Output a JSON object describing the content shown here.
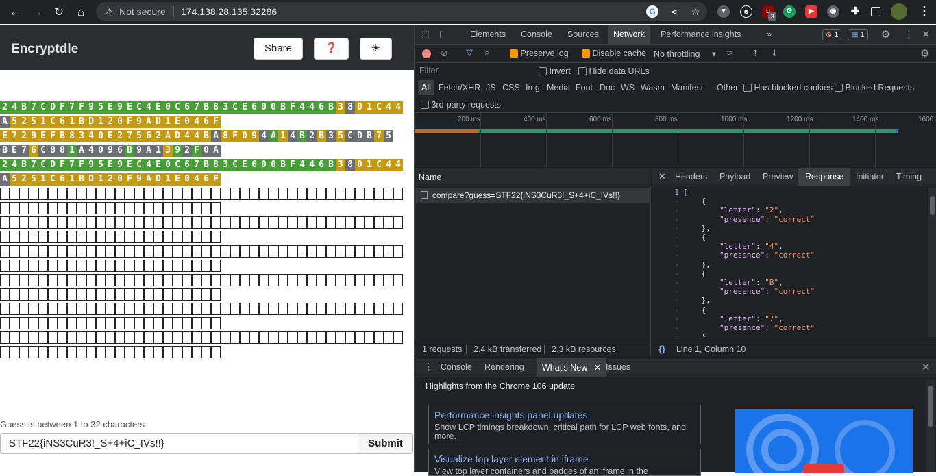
{
  "browser": {
    "security_label": "Not secure",
    "url": "174.138.28.135:32286",
    "extension_badge": "3"
  },
  "app": {
    "title": "Encryptdle",
    "share_label": "Share",
    "help_label": "❓",
    "theme_label": "☀",
    "hint": "Guess is between 1 to 32 characters",
    "guess_value": "STF22{iNS3CuR3!_S+4+iC_IVs!!}",
    "submit_label": "Submit",
    "board": [
      {
        "text": "24B7CDF7F95E9EC4E0C67B83CE600BF446B3801C44",
        "colors": "gggggggggggggggggggggggggggggggggggyxyyyyyyx"
      },
      {
        "text": "A5251C61BD120F9AD1E046F",
        "colors": "xyyyyyyyyyyyyyyyyyyyyyy"
      },
      {
        "text": "E729EFB8340E27562AD44BA8F094A14B2B35CDB75",
        "colors": "yyyyyyyyyyyyyyyyyyyyyyxyyyyxgyxgxyxyxxxyx"
      },
      {
        "text": "BE76C881A4096B9A1392F0A",
        "colors": "xxxyxxxgxxxxxgxxxygxgxx"
      },
      {
        "text": "24B7CDF7F95E9EC4E0C67B83CE600BF446B3801C44",
        "colors": "gggggggggggggggggggggggggggggggggggyxyyyyyyx"
      },
      {
        "text": "A5251C61BD120F9AD1E046F",
        "colors": "xyyyyyyyyyyyyyyyyyyyyyy"
      }
    ],
    "empty_rows": 12,
    "empty_row_lengths": [
      42,
      23
    ]
  },
  "devtools": {
    "tabs": [
      "Elements",
      "Console",
      "Sources",
      "Network",
      "Performance insights",
      "»"
    ],
    "active_tab": "Network",
    "error_count": "1",
    "message_count": "1",
    "preserve_log": "Preserve log",
    "disable_cache": "Disable cache",
    "throttling": "No throttling",
    "filter_placeholder": "Filter",
    "invert": "Invert",
    "hide_data_urls": "Hide data URLs",
    "types": [
      "All",
      "Fetch/XHR",
      "JS",
      "CSS",
      "Img",
      "Media",
      "Font",
      "Doc",
      "WS",
      "Wasm",
      "Manifest",
      "Other"
    ],
    "has_blocked_cookies": "Has blocked cookies",
    "blocked_requests": "Blocked Requests",
    "third_party": "3rd-party requests",
    "ticks": [
      "200 ms",
      "400 ms",
      "600 ms",
      "800 ms",
      "1000 ms",
      "1200 ms",
      "1400 ms",
      "1600"
    ],
    "name_header": "Name",
    "request_name": "compare?guess=STF22{iNS3CuR3!_S+4+iC_IVs!!}",
    "footer": {
      "requests": "1 requests",
      "transferred": "2.4 kB transferred",
      "resources": "2.3 kB resources"
    },
    "detail_tabs": [
      "Headers",
      "Payload",
      "Preview",
      "Response",
      "Initiator",
      "Timing"
    ],
    "active_detail": "Response",
    "cursor_pos": "Line 1, Column 10",
    "response_lines": [
      {
        "gutter": "1",
        "text": "["
      },
      {
        "gutter": "-",
        "text": "    {"
      },
      {
        "gutter": "-",
        "key": "\"letter\"",
        "value": "\"2\"",
        "indent": "        ",
        "sep": ": ",
        "tail": ","
      },
      {
        "gutter": "-",
        "key": "\"presence\"",
        "value": "\"correct\"",
        "indent": "        ",
        "sep": ": ",
        "tail": ""
      },
      {
        "gutter": "-",
        "text": "    },"
      },
      {
        "gutter": "-",
        "text": "    {"
      },
      {
        "gutter": "-",
        "key": "\"letter\"",
        "value": "\"4\"",
        "indent": "        ",
        "sep": ": ",
        "tail": ","
      },
      {
        "gutter": "-",
        "key": "\"presence\"",
        "value": "\"correct\"",
        "indent": "        ",
        "sep": ": ",
        "tail": ""
      },
      {
        "gutter": "-",
        "text": "    },"
      },
      {
        "gutter": "-",
        "text": "    {"
      },
      {
        "gutter": "-",
        "key": "\"letter\"",
        "value": "\"B\"",
        "indent": "        ",
        "sep": ": ",
        "tail": ","
      },
      {
        "gutter": "-",
        "key": "\"presence\"",
        "value": "\"correct\"",
        "indent": "        ",
        "sep": ": ",
        "tail": ""
      },
      {
        "gutter": "-",
        "text": "    },"
      },
      {
        "gutter": "-",
        "text": "    {"
      },
      {
        "gutter": "-",
        "key": "\"letter\"",
        "value": "\"7\"",
        "indent": "        ",
        "sep": ": ",
        "tail": ","
      },
      {
        "gutter": "-",
        "key": "\"presence\"",
        "value": "\"correct\"",
        "indent": "        ",
        "sep": ": ",
        "tail": ""
      },
      {
        "gutter": "-",
        "text": "    },"
      }
    ],
    "drawer_tabs": [
      "Console",
      "Rendering",
      "What's New",
      "Issues"
    ],
    "active_drawer": "What's New",
    "drawer_title": "Highlights from the Chrome 106 update",
    "cards": [
      {
        "title": "Performance insights panel updates",
        "body": "Show LCP timings breakdown, critical path for LCP web fonts, and more."
      },
      {
        "title": "Visualize top layer element in iframe",
        "body": "View top layer containers and badges of an iframe in the"
      }
    ]
  }
}
